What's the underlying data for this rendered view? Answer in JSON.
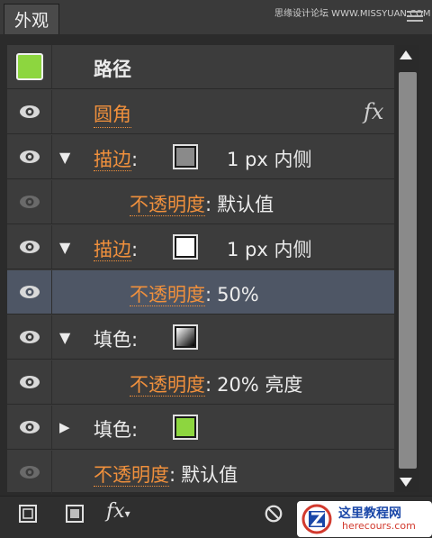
{
  "panel": {
    "tab_title": "外观",
    "watermark": "思缘设计论坛 WWW.MISSYUAN.COM"
  },
  "rows": [
    {
      "type": "header",
      "swatch_color": "#8dd63f",
      "label": "路径"
    },
    {
      "label": "圆角",
      "link": true,
      "fx": "fx"
    },
    {
      "label": "描边",
      "link": true,
      "colon": ":",
      "swatch_color": "#8a8a8a",
      "value": "1 px  内侧",
      "expanded": true
    },
    {
      "label": "不透明度",
      "link": true,
      "colon": ":",
      "value": "默认值",
      "eye_dim": true
    },
    {
      "label": "描边",
      "link": true,
      "colon": ":",
      "swatch_color": "#ffffff",
      "value": "1 px  内侧",
      "expanded": true
    },
    {
      "label": "不透明度",
      "link": true,
      "colon": ":",
      "value": "50%",
      "selected": true
    },
    {
      "label": "填色",
      "colon": ":",
      "swatch": "gradient",
      "expanded": true
    },
    {
      "label": "不透明度",
      "link": true,
      "colon": ":",
      "value": "20% 亮度"
    },
    {
      "label": "填色",
      "colon": ":",
      "swatch_color": "#8dd63f",
      "expanded": false
    },
    {
      "label": "不透明度",
      "link": true,
      "colon": ":",
      "value": "默认值",
      "eye_dim": true
    }
  ],
  "toolbar": {
    "fx_label": "fx"
  },
  "logo": {
    "cn": "这里教程网",
    "en": "herecours.com"
  }
}
